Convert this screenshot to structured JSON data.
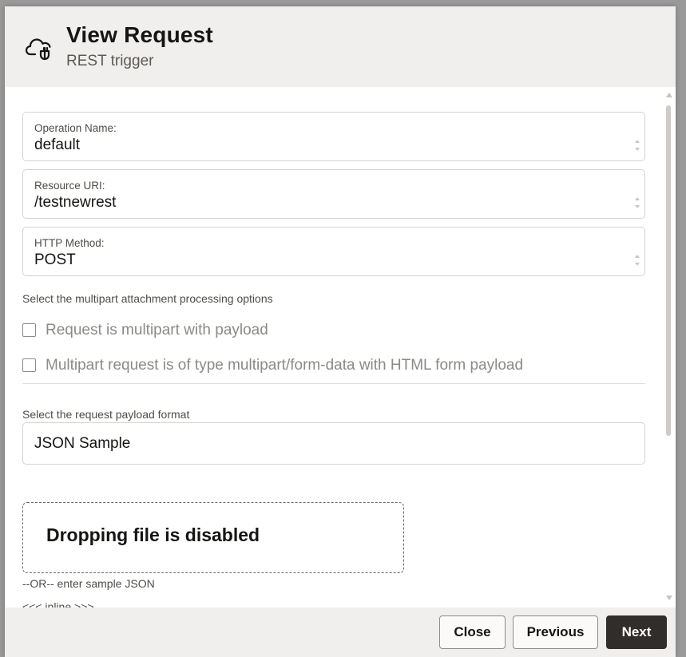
{
  "header": {
    "title": "View Request",
    "subtitle": "REST trigger",
    "icon": "cloud-plug-icon"
  },
  "fields": [
    {
      "label": "Operation Name:",
      "value": "default"
    },
    {
      "label": "Resource URI:",
      "value": "/testnewrest"
    },
    {
      "label": "HTTP Method:",
      "value": "POST"
    }
  ],
  "multipart": {
    "section_label": "Select the multipart attachment processing options",
    "options": [
      {
        "label": "Request is multipart with payload",
        "checked": false
      },
      {
        "label": "Multipart request is of type multipart/form-data with HTML form payload",
        "checked": false
      }
    ]
  },
  "payload": {
    "section_label": "Select the request payload format",
    "format_value": "JSON Sample",
    "dropzone_text": "Dropping file is disabled",
    "or_label": "--OR-- enter sample JSON",
    "inline_label": "<<< inline >>>"
  },
  "footer": {
    "close_label": "Close",
    "previous_label": "Previous",
    "next_label": "Next"
  },
  "colors": {
    "primary_button": "#312d2a",
    "header_bg": "#f1efed",
    "text": "#161513"
  }
}
